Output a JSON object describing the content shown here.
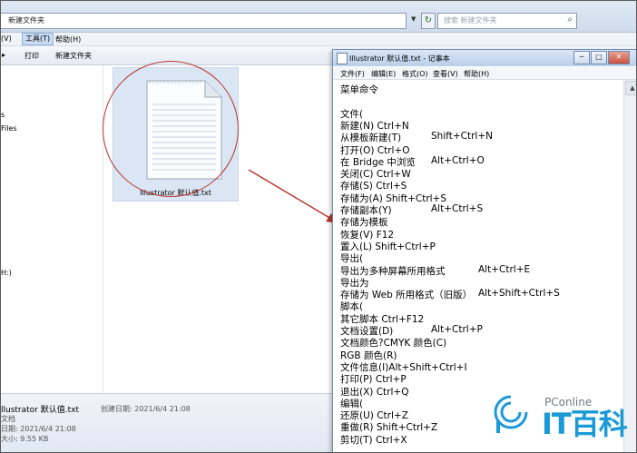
{
  "explorer": {
    "address": "新建文件夹",
    "search_placeholder": "搜索 新建文件夹",
    "menu": [
      {
        "label": "(V)"
      },
      {
        "label": "工具(T)"
      },
      {
        "label": "帮助(H)"
      }
    ],
    "toolbar": [
      {
        "label": "▸"
      },
      {
        "label": "打印"
      },
      {
        "label": "新建文件夹"
      }
    ],
    "sidebar_items": [
      {
        "label": "s"
      },
      {
        "label": "Files"
      },
      {
        "label": "H:)"
      }
    ],
    "file_name": "Illustrator 默认值.txt",
    "status": {
      "name": "llustrator 默认值.txt",
      "type": "文档",
      "modified": "日期: 2021/6/4 21:08",
      "size_label": "大小: 9.55 KB",
      "created": "创建日期: 2021/6/4 21:08"
    }
  },
  "notepad": {
    "title": "Illustrator 默认值.txt - 记事本",
    "controls": {
      "minimize": "─",
      "maximize": "□",
      "close": "✕"
    },
    "menu": [
      "文件(F)",
      "编辑(E)",
      "格式(O)",
      "查看(V)",
      "帮助(H)"
    ],
    "lines": [
      {
        "a": "菜单命令",
        "b": ""
      },
      {
        "a": "",
        "b": ""
      },
      {
        "a": "文件(",
        "b": ""
      },
      {
        "a": "新建(N)     Ctrl+N",
        "b": ""
      },
      {
        "a": "从模板新建(T)",
        "b": "Shift+Ctrl+N"
      },
      {
        "a": "打开(O)     Ctrl+O",
        "b": ""
      },
      {
        "a": "在 Bridge 中浏览",
        "b": "Alt+Ctrl+O"
      },
      {
        "a": "关闭(C)     Ctrl+W",
        "b": ""
      },
      {
        "a": "存储(S)     Ctrl+S",
        "b": ""
      },
      {
        "a": "存储为(A)  Shift+Ctrl+S",
        "b": ""
      },
      {
        "a": "存储副本(Y)",
        "b": "Alt+Ctrl+S"
      },
      {
        "a": "存储为模板",
        "b": ""
      },
      {
        "a": "恢复(V)     F12",
        "b": ""
      },
      {
        "a": "置入(L)     Shift+Ctrl+P",
        "b": ""
      },
      {
        "a": "导出(",
        "b": ""
      },
      {
        "a": "导出为多种屏幕所用格式",
        "b": "Alt+Ctrl+E"
      },
      {
        "a": "导出为",
        "b": ""
      },
      {
        "a": "存储为 Web 所用格式（旧版）",
        "b": "Alt+Shift+Ctrl+S"
      },
      {
        "a": "脚本(",
        "b": ""
      },
      {
        "a": "其它脚本   Ctrl+F12",
        "b": ""
      },
      {
        "a": "文档设置(D)",
        "b": "Alt+Ctrl+P"
      },
      {
        "a": "文档颜色?CMYK 颜色(C)",
        "b": ""
      },
      {
        "a": "RGB 颜色(R)",
        "b": ""
      },
      {
        "a": "文件信息(I)Alt+Shift+Ctrl+I",
        "b": ""
      },
      {
        "a": "打印(P)     Ctrl+P",
        "b": ""
      },
      {
        "a": "退出(X)     Ctrl+Q",
        "b": ""
      },
      {
        "a": "编辑(",
        "b": ""
      },
      {
        "a": "还原(U)     Ctrl+Z",
        "b": ""
      },
      {
        "a": "重做(R)     Shift+Ctrl+Z",
        "b": ""
      },
      {
        "a": "剪切(T)     Ctrl+X",
        "b": ""
      }
    ]
  },
  "watermark": {
    "brand": "PConline",
    "name": "IT百科"
  },
  "colors": {
    "annotation": "#b8332e",
    "watermark": "#1a9ad6"
  }
}
